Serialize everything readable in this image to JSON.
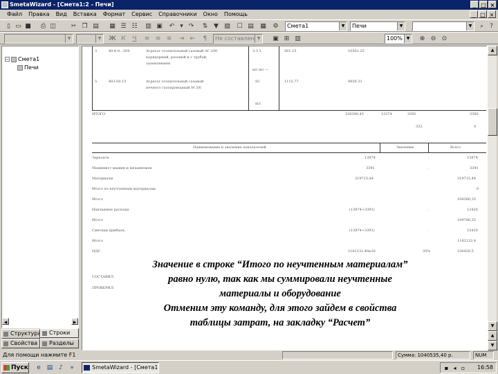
{
  "window": {
    "title": "SmetaWizard - [Смета1:2 - Печи]",
    "controls": [
      "_",
      "□",
      "×"
    ],
    "doc_controls": [
      "_",
      "□",
      "×"
    ]
  },
  "menu": [
    "Файл",
    "Правка",
    "Вид",
    "Вставка",
    "Формат",
    "Сервис",
    "Справочники",
    "Окно",
    "Помощь"
  ],
  "toolbar1": {
    "estimate_combo": "Смета1",
    "section_combo": "Печи"
  },
  "toolbar2": {
    "style_combo": "Не составлено_ре",
    "zoom_combo": "100%"
  },
  "tree": {
    "root": "Смета1",
    "child": "Печи"
  },
  "tabs": [
    "Структура",
    "Строки",
    "Свойства",
    "Разделы"
  ],
  "document": {
    "rows": [
      {
        "num": "3",
        "code": "40-6-0...504",
        "desc1": "Агрегат отопительный газовый АГ-200",
        "desc2": "коридорный, разовый и с трубой,",
        "desc3": "заземлением",
        "qty": "3.3.3",
        "price": "561.25",
        "total": "10502.25"
      },
      {
        "num": "5",
        "code": "403.00.15",
        "desc1": "Агрегат отопительный газовый",
        "desc2": "печного газопроводный М 3/6",
        "qty": "92",
        "price": "1115.77",
        "total": "8950.31",
        "unit": "m3"
      }
    ],
    "unit_top": "шт шт —",
    "total_row": {
      "label": "ИТОГО",
      "v1": "330380,45",
      "v2": "13374",
      "v3": "3391",
      "v4": "3360",
      "sub1": "332",
      "sub2": "0"
    },
    "summary_header": [
      "Наименование и значение показателей",
      "Значение",
      "Всего"
    ],
    "summary_rows": [
      {
        "label": "Зарплата",
        "value": "13874",
        "sep": ".",
        "total": "13874"
      },
      {
        "label": "Машинист машин и механизмов",
        "value": "3391",
        "sep": ".",
        "total": "3391"
      },
      {
        "label": "Материалы",
        "value": "319715,44",
        "sep": "",
        "total": "319715,44"
      },
      {
        "label": "Итого по неучтенным материалам",
        "value": "",
        "sep": "",
        "total": "0"
      },
      {
        "label": "Итого",
        "value": "",
        "sep": "",
        "total": "109360,35"
      },
      {
        "label": "Накладные расходы",
        "value": "(13874+3391)",
        "sep": ".",
        "total": "12426"
      },
      {
        "label": "Итого",
        "value": "",
        "sep": "",
        "total": "109786,35"
      },
      {
        "label": "Сметная прибыль",
        "value": "(13874+3391)",
        "sep": ".",
        "total": "15420"
      },
      {
        "label": "Итого",
        "value": "",
        "sep": "",
        "total": "1182132,4"
      },
      {
        "label": "НДС",
        "value": "1182132,40к20",
        "sep": "20%",
        "total": "236426,5"
      }
    ],
    "footer": [
      "СОСТАВИЛ",
      "ПРОВЕРИЛ"
    ]
  },
  "callout": [
    "Значение в строке “Итого по неучтенным материалам”",
    "равно нулю, так как мы суммировали неучтенные",
    "материалы и оборудование",
    "Отменим эту команду, для этого зайдем в свойства",
    "таблицы затрат, на закладку “Расчет”"
  ],
  "status": {
    "help": "Для помощи нажмите F1",
    "sum": "Сумма: 1040535,40 р.",
    "num": "NUM"
  },
  "taskbar": {
    "start": "Пуск",
    "task": "SmetaWizard - [Смета1...",
    "clock": "16:58"
  }
}
